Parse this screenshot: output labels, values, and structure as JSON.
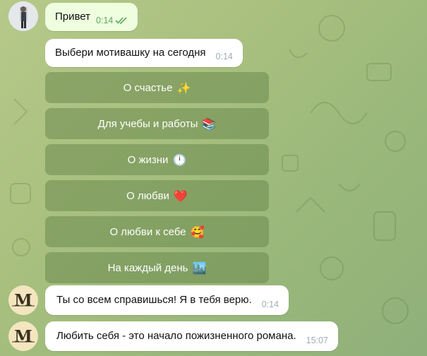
{
  "messages": {
    "user_hello": {
      "text": "Привет",
      "time": "0:14"
    },
    "bot_choose": {
      "text": "Выбери мотивашку на сегодня",
      "time": "0:14"
    },
    "bot_support": {
      "text": "Ты со всем справишься! Я в тебя верю.",
      "time": "0:14"
    },
    "bot_quote": {
      "text": "Любить себя - это начало пожизненного романа.",
      "time": "15:07"
    }
  },
  "keyboard": {
    "buttons": [
      {
        "label": "О счастье",
        "emoji": "✨"
      },
      {
        "label": "Для учебы и работы",
        "emoji": "📚"
      },
      {
        "label": "О жизни",
        "emoji": "🕛"
      },
      {
        "label": "О любви",
        "emoji": "❤️"
      },
      {
        "label": "О любви к себе",
        "emoji": "🥰"
      },
      {
        "label": "На каждый день",
        "emoji": "🏙️"
      }
    ]
  },
  "bot": {
    "avatar_letter": "M"
  },
  "colors": {
    "button_bg": "#6c8a4e",
    "outgoing_bubble": "#eefedf",
    "read_checks": "#5fa85e"
  }
}
